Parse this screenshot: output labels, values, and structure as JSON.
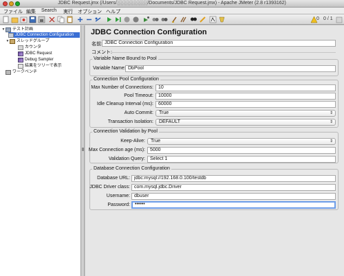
{
  "window": {
    "title": "JDBC Request.jmx (/Users/░░░░░░░░░/Documents/JDBC Request.jmx) - Apache JMeter (2.8 r1393162)"
  },
  "menu": [
    "ファイル",
    "編集",
    "Search",
    "実行",
    "オプション",
    "ヘルプ"
  ],
  "toolbar": {
    "status_text": "0 / 1",
    "warning_count": "0",
    "icons": [
      "new-icon",
      "templates-icon",
      "open-icon",
      "close-file-icon",
      "save-icon",
      "save-as-icon",
      "cut-icon",
      "copy-icon",
      "paste-icon",
      "expand-icon",
      "collapse-icon",
      "toggle-icon",
      "start-icon",
      "start-no-pause-icon",
      "stop-icon",
      "shutdown-icon",
      "remote-start-icon",
      "remote-stop-icon",
      "remote-shutdown-icon",
      "clear-icon",
      "clear-all-icon",
      "search-icon",
      "reset-search-icon",
      "function-helper-icon",
      "help-icon"
    ]
  },
  "tree": {
    "items": [
      {
        "label": "テスト計画"
      },
      {
        "label": "JDBC Connection Configuration"
      },
      {
        "label": "スレッドグループ"
      },
      {
        "label": "カウンタ"
      },
      {
        "label": "JDBC Request"
      },
      {
        "label": "Debug Sampler"
      },
      {
        "label": "結果をツリーで表示"
      },
      {
        "label": "ワークベンチ"
      }
    ]
  },
  "panel": {
    "title": "JDBC Connection Configuration",
    "name_label": "名前:",
    "name_value": "JDBC Connection Configuration",
    "comment_label": "コメント:",
    "comment_value": "",
    "var_group": {
      "title": "Variable Name Bound to Pool",
      "var_label": "Variable Name:",
      "var_value": "DbPool"
    },
    "pool_group": {
      "title": "Connection Pool Configuration",
      "max_conn_label": "Max Number of Connections:",
      "max_conn_value": "10",
      "timeout_label": "Pool Timeout:",
      "timeout_value": "10000",
      "idle_label": "Idle Cleanup Interval (ms):",
      "idle_value": "60000",
      "autocommit_label": "Auto Commit:",
      "autocommit_value": "True",
      "isolation_label": "Transaction Isolation:",
      "isolation_value": "DEFAULT"
    },
    "validation_group": {
      "title": "Connection Validation by Pool",
      "keepalive_label": "Keep-Alive:",
      "keepalive_value": "True",
      "age_label": "Max Connection age (ms):",
      "age_value": "5000",
      "query_label": "Validation Query:",
      "query_value": "Select 1"
    },
    "db_group": {
      "title": "Database Connection Configuration",
      "url_label": "Database URL:",
      "url_value": "jdbc:mysql://192.168.0.100/testdb",
      "driver_label": "JDBC Driver class:",
      "driver_value": "com.mysql.jdbc.Driver",
      "user_label": "Username:",
      "user_value": "dbuser",
      "password_label": "Password:",
      "password_value": "••••••"
    }
  }
}
